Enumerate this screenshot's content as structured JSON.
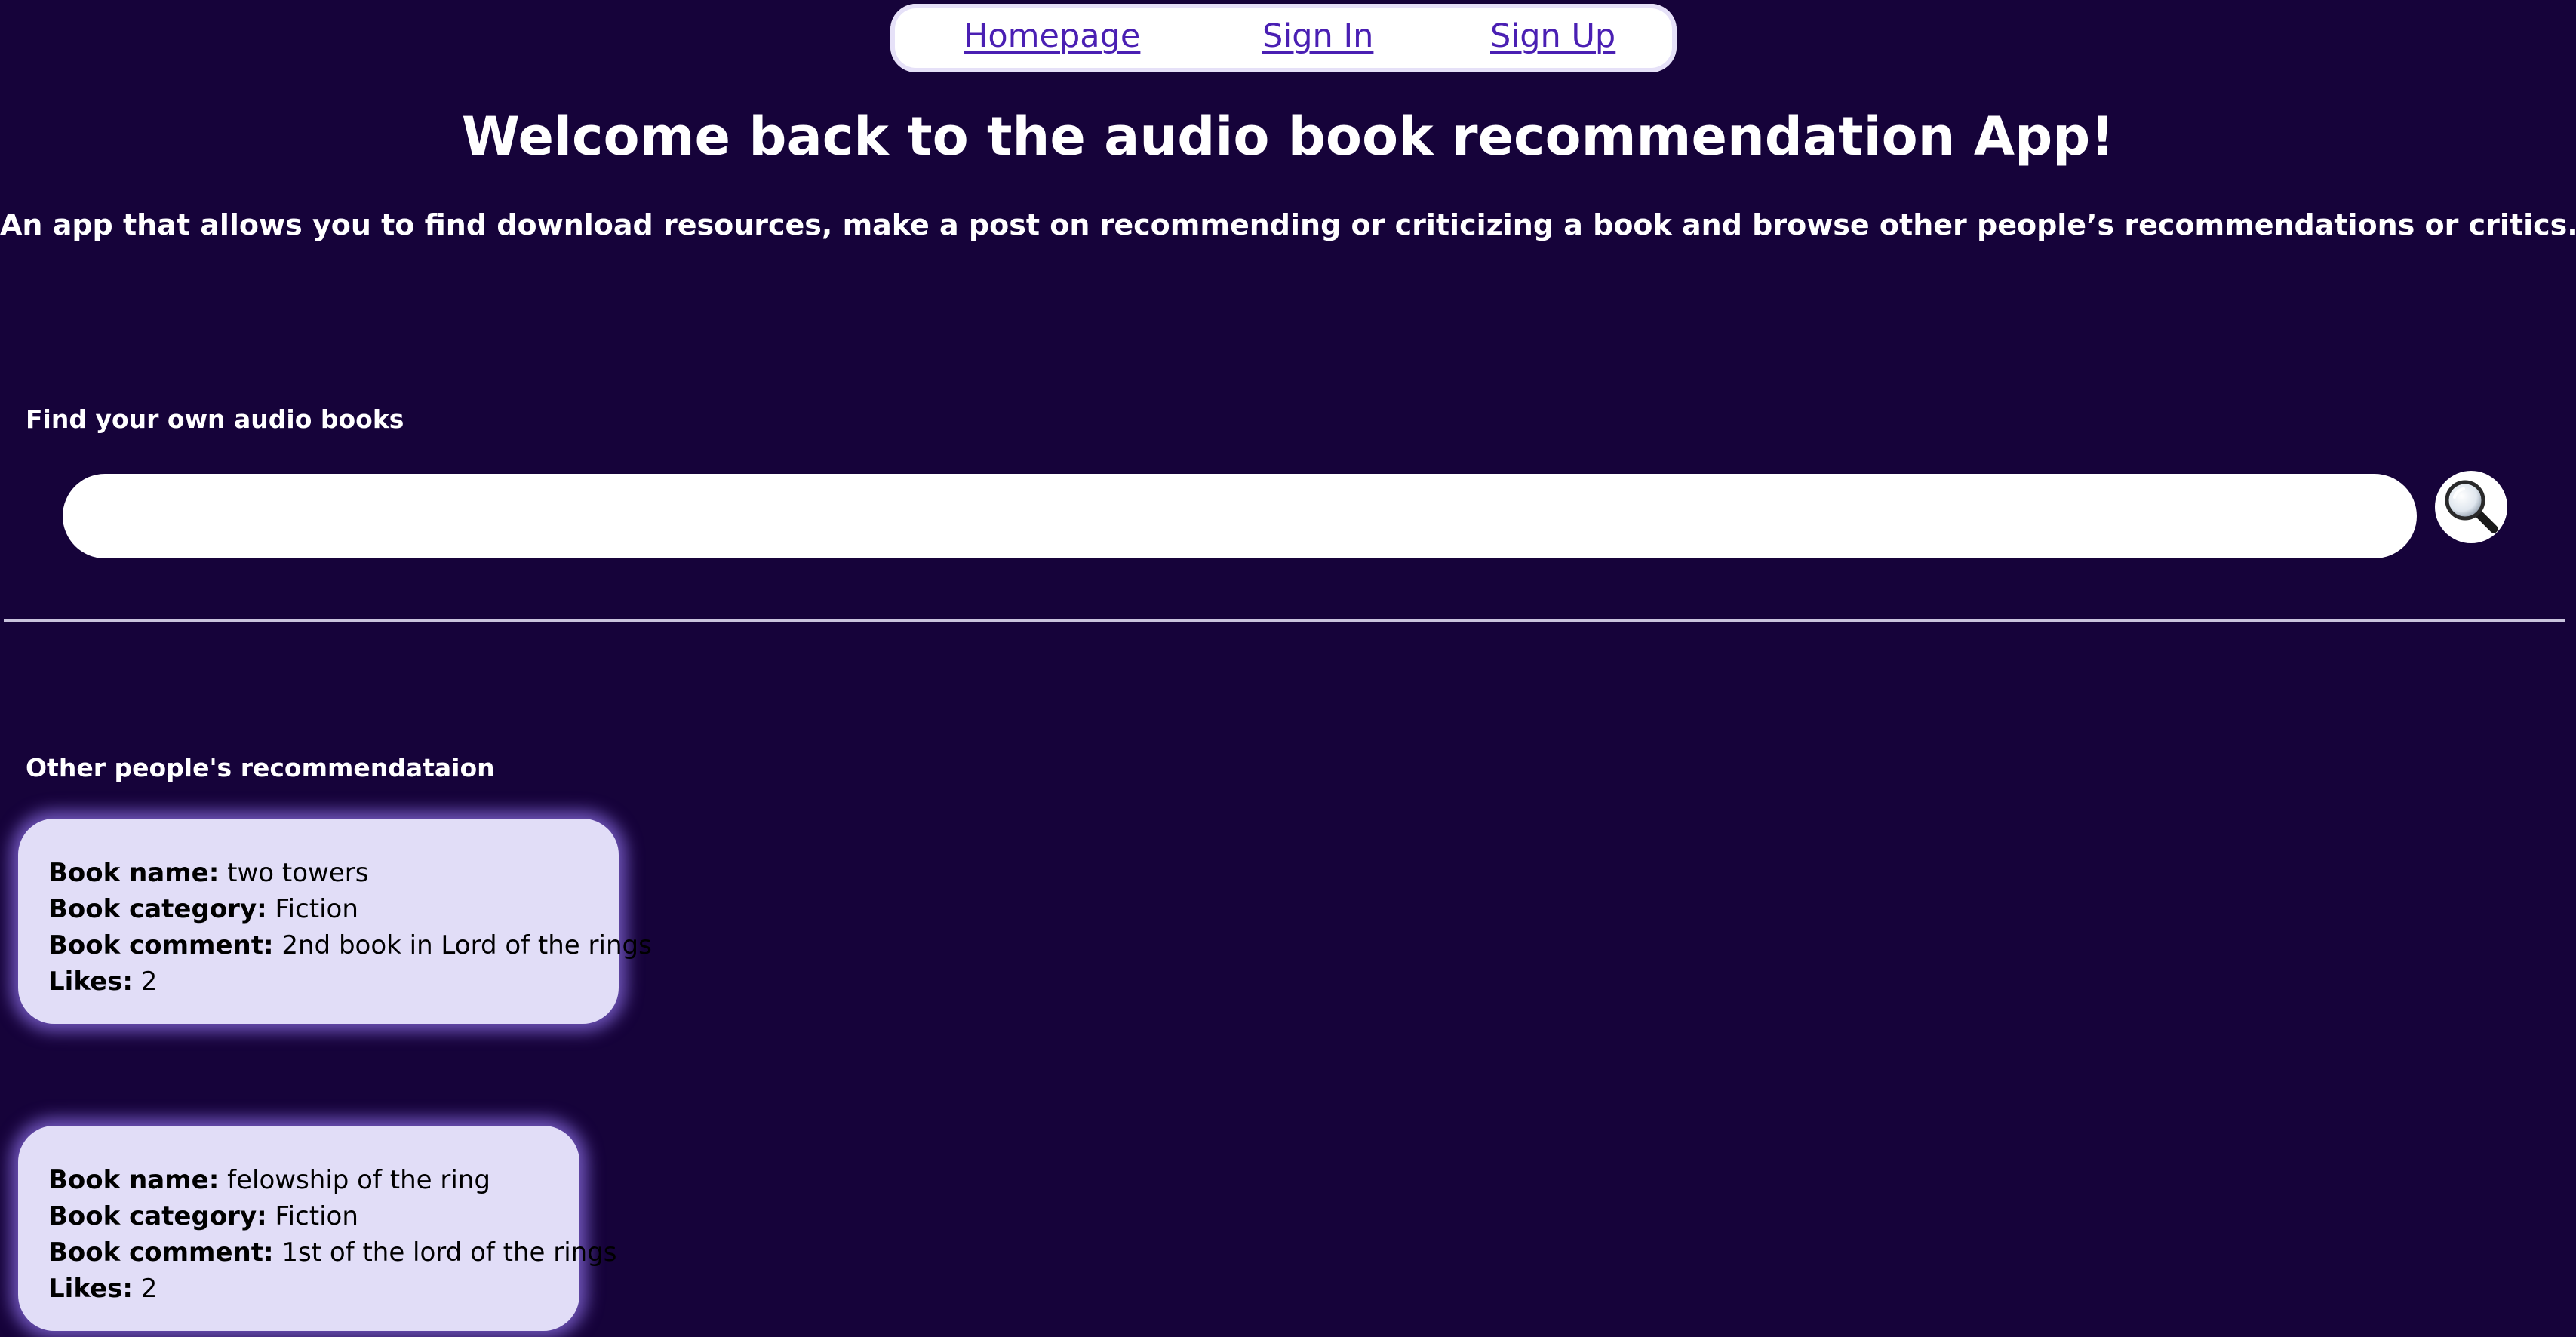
{
  "nav": {
    "homepage": "Homepage",
    "sign_in": "Sign In",
    "sign_up": "Sign Up"
  },
  "header": {
    "title": "Welcome back to the audio book recommendation App!",
    "subtitle": "An app that allows you to find download resources, make a post on recommending or criticizing a book and browse other people’s recommendations or critics."
  },
  "search": {
    "label": "Find your own audio books",
    "value": "",
    "placeholder": "",
    "button_icon": "magnifying-glass-icon"
  },
  "recommendations": {
    "label": "Other people's recommendataion",
    "field_labels": {
      "name": "Book name:",
      "category": "Book category:",
      "comment": "Book comment:",
      "likes": "Likes:"
    },
    "items": [
      {
        "name": "two towers",
        "category": "Fiction",
        "comment": "2nd book in Lord of the rings",
        "likes": "2"
      },
      {
        "name": "felowship of the ring",
        "category": "Fiction",
        "comment": "1st of the lord of the rings",
        "likes": "2"
      }
    ]
  },
  "colors": {
    "background": "#16033a",
    "nav_link": "#4a1fb3",
    "card_bg": "#e1ddf7",
    "card_glow": "#8e70e6"
  }
}
